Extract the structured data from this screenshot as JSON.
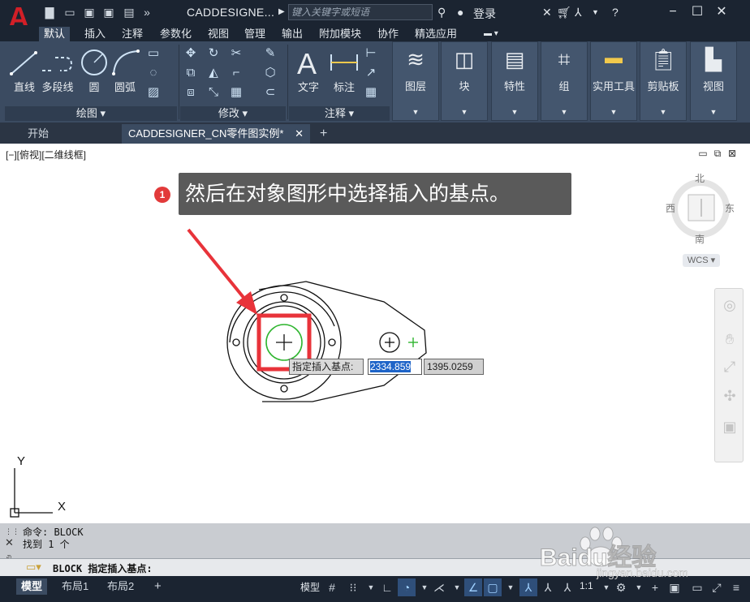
{
  "app": {
    "logo_letter": "A",
    "doc_title": "CADDESIGNE...",
    "search_placeholder": "键入关键字或短语",
    "login_label": "登录"
  },
  "ribbon_tabs": [
    "默认",
    "插入",
    "注释",
    "参数化",
    "视图",
    "管理",
    "输出",
    "附加模块",
    "协作",
    "精选应用"
  ],
  "draw_panel": {
    "title": "绘图",
    "tools": [
      "直线",
      "多段线",
      "圆",
      "圆弧"
    ]
  },
  "modify_panel": {
    "title": "修改"
  },
  "annotation_panel": {
    "title": "注释",
    "tools": [
      "文字",
      "标注"
    ]
  },
  "group_panels": [
    "图层",
    "块",
    "特性",
    "组",
    "实用工具",
    "剪贴板",
    "视图"
  ],
  "doc_tabs": [
    "开始",
    "CADDESIGNER_CN零件图实例*"
  ],
  "viewport": {
    "label": "[−][俯视][二维线框]",
    "callout_number": "1",
    "callout_text": "然后在对象图形中选择插入的基点。",
    "tooltip_label": "指定插入基点:",
    "x_value": "2334.859",
    "y_value": "1395.0259"
  },
  "viewcube": {
    "north": "北",
    "south": "南",
    "east": "东",
    "west": "西",
    "wcs": "WCS"
  },
  "ucs": {
    "x": "X",
    "y": "Y"
  },
  "command": {
    "history": [
      "命令: BLOCK",
      "找到 1 个"
    ],
    "prompt": "BLOCK 指定插入基点:"
  },
  "layout_tabs": [
    "模型",
    "布局1",
    "布局2"
  ],
  "status": {
    "model_label": "模型",
    "scale": "1:1"
  },
  "watermark": {
    "brand": "Baidu经验",
    "url": "jingyan.baidu.com"
  },
  "colors": {
    "titlebar": "#1b2431",
    "ribbon": "#3b4b61",
    "callout_bg": "#5a5a5a",
    "highlight_red": "#e8333a",
    "circle_green": "#2fb52f",
    "value_selected": "#1e64c8"
  }
}
